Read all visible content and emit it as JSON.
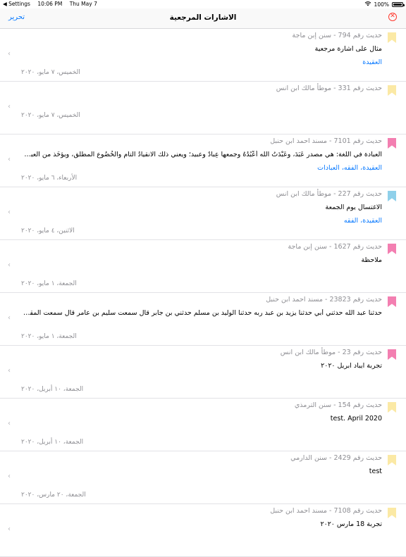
{
  "status": {
    "back_app": "◀ Settings",
    "time": "10:06 PM",
    "date": "Thu May 7",
    "battery": "100%"
  },
  "nav": {
    "edit_label": "تحرير",
    "title": "الاشارات المرجعية"
  },
  "items": [
    {
      "head": "حديث رقم   794 - سنن إبن ماجة",
      "text": "مثال على اشارة مرجعية",
      "tags": "العقيدة",
      "date": "الخميس، ٧ مايو، ٢٠٢٠",
      "color": "#fbe9a5"
    },
    {
      "head": "حديث رقم   331 - موطأ مالك ابن انس",
      "text": "",
      "tags": "",
      "date": "الخميس، ٧ مايو، ٢٠٢٠",
      "color": "#fbe9a5"
    },
    {
      "head": "حديث رقم   7101 - مسند احمد ابن حنبل",
      "text": "العبادة في اللغة: هي مصدر عَبَدَ، وعَبْدَتُ الله أَعْبُدُهُ وجمعها عِبادٌ وعبيد؛ ويعني ذلك الانقيادُ التام والخُضُوع المطلق، ويؤخَذ من العبادة ويوا...",
      "tags": "العقيدة، الفقه، العبادات",
      "date": "الأربعاء، ٦ مايو، ٢٠٢٠",
      "color": "#f37fb1"
    },
    {
      "head": "حديث رقم   227 - موطأ مالك ابن انس",
      "text": "الاغتسال يوم الجمعة",
      "tags": "العقيدة، الفقه",
      "date": "الاثنين، ٤ مايو، ٢٠٢٠",
      "color": "#8fd0ea"
    },
    {
      "head": "حديث رقم   1627 - سنن إبن ماجة",
      "text": "ملاحظة",
      "tags": "",
      "date": "الجمعة، ١ مايو، ٢٠٢٠",
      "color": "#f37fb1"
    },
    {
      "head": "حديث رقم   23823 - مسند احمد ابن حنبل",
      "text": "حدثنا عبد الله حدثني أبي حدثنا يزيد بن عبد ربه حدثنا الوليد بن مسلم حدثني بن جابر قال سمعت سليم بن عامر قال سمعت المقداد بن الأس...",
      "tags": "",
      "date": "الجمعة، ١ مايو، ٢٠٢٠",
      "color": "#f37fb1"
    },
    {
      "head": "حديث رقم   23 - موطأ مالك ابن انس",
      "text": "تجربة ايباد ابريل ٢٠٢٠",
      "tags": "",
      "date": "الجمعة، ١٠ أبريل، ٢٠٢٠",
      "color": "#f37fb1"
    },
    {
      "head": "حديث رقم   154 - سنن الترمذي",
      "text": "test. April 2020",
      "tags": "",
      "date": "الجمعة، ١٠ أبريل، ٢٠٢٠",
      "color": "#fbe9a5"
    },
    {
      "head": "حديث رقم   2429 - سنن الدارمي",
      "text": "test",
      "tags": "",
      "date": "الجمعة، ٢٠ مارس، ٢٠٢٠",
      "color": "#fbe9a5"
    },
    {
      "head": "حديث رقم   7108 - مسند احمد ابن حنبل",
      "text": "تجربة 18 مارس ٢٠٢٠",
      "tags": "",
      "date": "",
      "color": "#fbe9a5"
    }
  ]
}
